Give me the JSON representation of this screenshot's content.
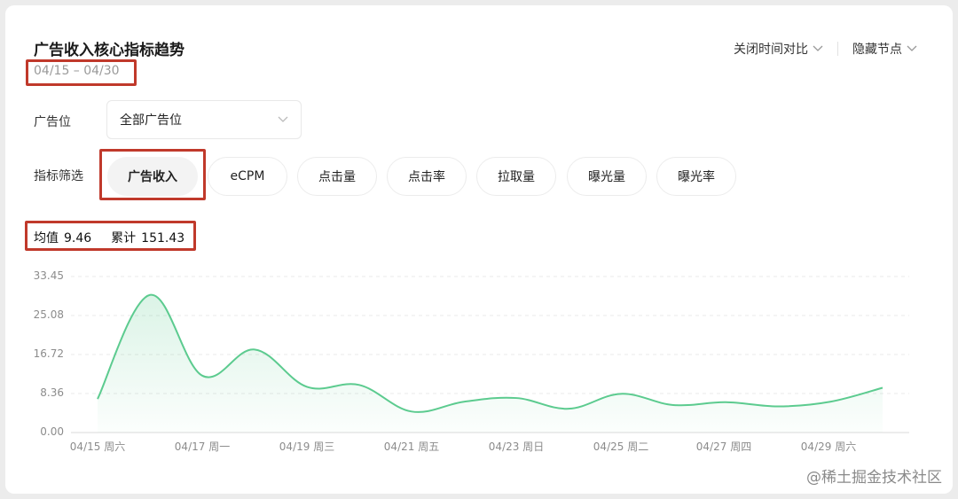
{
  "header": {
    "title": "广告收入核心指标趋势",
    "date_range": "04/15 – 04/30",
    "compare_toggle": "关闭时间对比",
    "hide_nodes_toggle": "隐藏节点"
  },
  "filters": {
    "slot_label": "广告位",
    "slot_selected": "全部广告位",
    "metric_label": "指标筛选",
    "metrics": [
      "广告收入",
      "eCPM",
      "点击量",
      "点击率",
      "拉取量",
      "曝光量",
      "曝光率"
    ],
    "active_metric": "广告收入"
  },
  "summary": {
    "avg_label": "均值",
    "avg_value": "9.46",
    "total_label": "累计",
    "total_value": "151.43"
  },
  "chart_data": {
    "type": "area",
    "title": "",
    "xlabel": "",
    "ylabel": "",
    "ylim": [
      0,
      33.45
    ],
    "yticks": [
      "33.45",
      "25.08",
      "16.72",
      "8.36",
      "0.00"
    ],
    "xtick_labels": [
      "04/15 周六",
      "04/17 周一",
      "04/19 周三",
      "04/21 周五",
      "04/23 周日",
      "04/25 周二",
      "04/27 周四",
      "04/29 周六"
    ],
    "x": [
      "04/15",
      "04/16",
      "04/17",
      "04/18",
      "04/19",
      "04/20",
      "04/21",
      "04/22",
      "04/23",
      "04/24",
      "04/25",
      "04/26",
      "04/27",
      "04/28",
      "04/29",
      "04/30"
    ],
    "series": [
      {
        "values": [
          7.2,
          29.5,
          12.2,
          17.8,
          9.8,
          10.2,
          4.5,
          6.6,
          7.4,
          5.1,
          8.3,
          5.9,
          6.5,
          5.6,
          6.6,
          9.6
        ]
      }
    ],
    "grid": true,
    "line_color": "#5ccb8f"
  },
  "watermark": "@稀土掘金技术社区"
}
